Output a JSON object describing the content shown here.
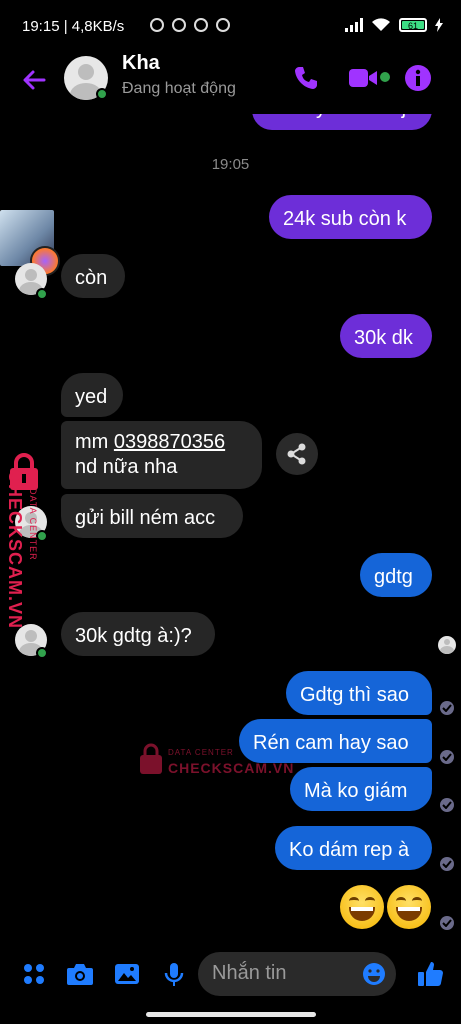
{
  "status_bar": {
    "time_speed": "19:15 | 4,8KB/s",
    "battery": "61"
  },
  "header": {
    "name": "Kha",
    "status": "Đang hoạt động"
  },
  "messages": {
    "cut_off": "M mấy cái đéo j",
    "timestamp": "19:05",
    "m1": "24k sub còn k",
    "m2": "còn",
    "m3": "30k dk",
    "m4": "yed",
    "m5_prefix": "mm ",
    "m5_phone": "0398870356",
    "m5_line2": "nd nữa nha",
    "m6": "gửi bill ném acc",
    "m7": "gdtg",
    "m8": "30k gdtg à:)?",
    "m9": "Gdtg thì sao",
    "m10": "Rén cam hay sao",
    "m11": "Mà ko giám",
    "m12": "Ko dám rep à"
  },
  "watermark": {
    "brand": "CHECKSCAM.VN",
    "tag": "DATA CENTER"
  },
  "composer": {
    "placeholder": "Nhắn tin"
  },
  "colors": {
    "accent": "#a033ff",
    "outgoing_purple": "#6d2ed8",
    "outgoing_blue": "#1565d8",
    "incoming": "#262626"
  }
}
